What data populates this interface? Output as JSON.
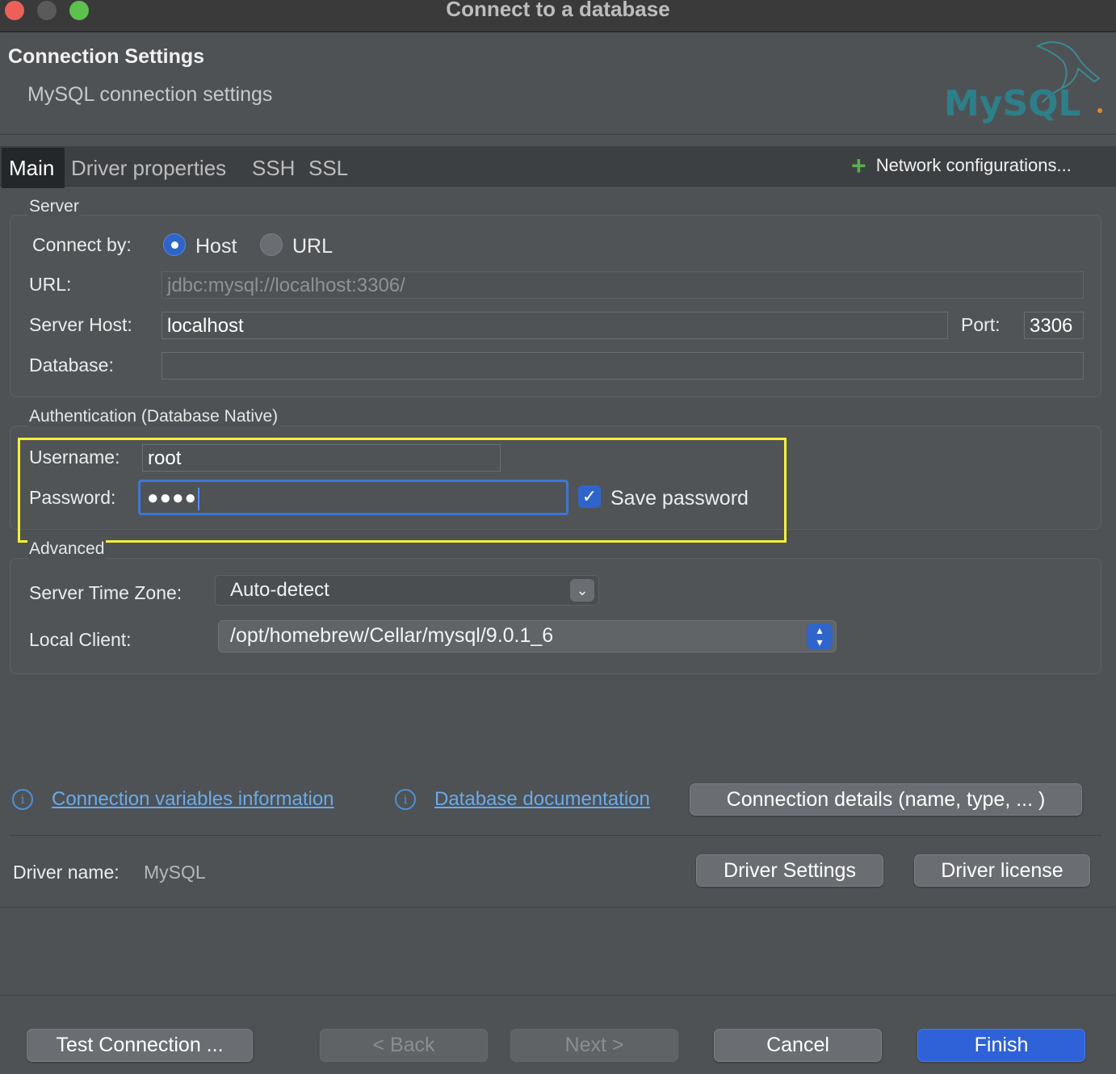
{
  "window": {
    "title": "Connect to a database"
  },
  "header": {
    "title": "Connection Settings",
    "subtitle": "MySQL connection settings",
    "logo_text": "MySQL"
  },
  "tabs": {
    "items": [
      "Main",
      "Driver properties",
      "SSH",
      "SSL"
    ],
    "active": "Main",
    "network_config_label": "Network configurations..."
  },
  "server": {
    "group_title": "Server",
    "connect_by_label": "Connect by:",
    "options": [
      "Host",
      "URL"
    ],
    "selected": "Host",
    "url_label": "URL:",
    "url_value": "jdbc:mysql://localhost:3306/",
    "host_label": "Server Host:",
    "host_value": "localhost",
    "port_label": "Port:",
    "port_value": "3306",
    "database_label": "Database:",
    "database_value": ""
  },
  "auth": {
    "group_title": "Authentication (Database Native)",
    "username_label": "Username:",
    "username_value": "root",
    "password_label": "Password:",
    "password_masked": "●●●●",
    "save_password_label": "Save password",
    "save_password_checked": true
  },
  "advanced": {
    "group_title": "Advanced",
    "timezone_label": "Server Time Zone:",
    "timezone_value": "Auto-detect",
    "local_client_label": "Local Client:",
    "local_client_value": "/opt/homebrew/Cellar/mysql/9.0.1_6"
  },
  "links": {
    "conn_vars": "Connection variables information",
    "db_docs": "Database documentation",
    "conn_details_button": "Connection details (name, type, ... )"
  },
  "driver": {
    "name_label": "Driver name:",
    "name_value": "MySQL",
    "settings_button": "Driver Settings",
    "license_button": "Driver license"
  },
  "footer": {
    "test_button": "Test Connection ...",
    "back_button": "< Back",
    "next_button": "Next >",
    "cancel_button": "Cancel",
    "finish_button": "Finish"
  },
  "colors": {
    "accent": "#2f62d8",
    "highlight_box": "#f5f03a",
    "link": "#6aabea",
    "plus": "#56b04b"
  }
}
